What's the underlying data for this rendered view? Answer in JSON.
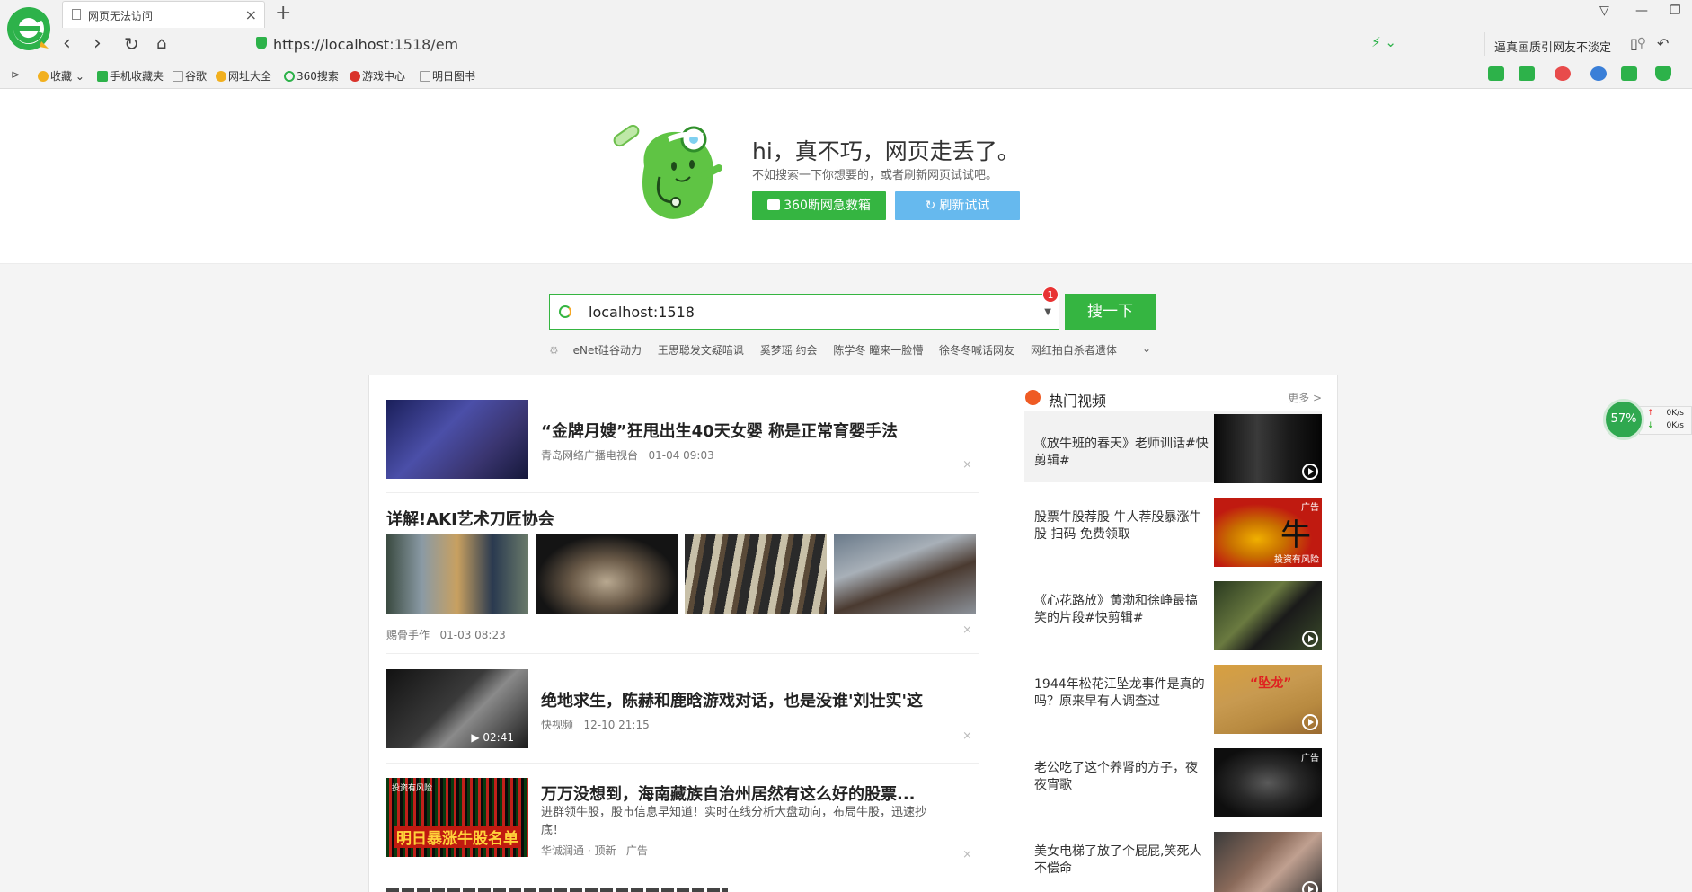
{
  "window": {
    "tab_title": "网页无法访问",
    "new_tab": "+",
    "url_prefix": "https://",
    "url_host": "localhost",
    "url_rest": ":1518/em",
    "search_placeholder": "逼真画质引网友不淡定"
  },
  "bookmarks": [
    {
      "label": "收藏",
      "color": "#f2b01e"
    },
    {
      "label": "手机收藏夹",
      "color": "#2db24a"
    },
    {
      "label": "谷歌",
      "color": "#999999"
    },
    {
      "label": "网址大全",
      "color": "#f2b01e"
    },
    {
      "label": "360搜索",
      "color": "#2db24a"
    },
    {
      "label": "游戏中心",
      "color": "#d9332b"
    },
    {
      "label": "明日图书",
      "color": "#999999"
    }
  ],
  "error": {
    "title": "hi，真不巧，网页走丢了。",
    "subtitle": "不如搜索一下你想要的，或者刷新网页试试吧。",
    "rescue_button": "360断网急救箱",
    "refresh_button": "刷新试试"
  },
  "search": {
    "value": "localhost:1518",
    "badge": "1",
    "button": "搜一下",
    "hot_words": [
      "eNet硅谷动力",
      "王思聪发文疑暗讽",
      "奚梦瑶 约会",
      "陈学冬 瞳来一脸懵",
      "徐冬冬喊话网友",
      "网红拍自杀者遗体"
    ]
  },
  "news": [
    {
      "title": "“金牌月嫂”狂甩出生40天女婴 称是正常育婴手法",
      "source": "青岛网络广播电视台",
      "time": "01-04 09:03"
    },
    {
      "title": "详解!AKI艺术刀匠协会",
      "source": "赐骨手作",
      "time": "01-03 08:23"
    },
    {
      "title": "绝地求生，陈赫和鹿晗游戏对话，也是没谁'刘壮实'这",
      "source": "快视频",
      "time": "12-10 21:15",
      "duration": "02:41"
    },
    {
      "title": "万万没想到，海南藏族自治州居然有这么好的股票...",
      "desc": "进群领牛股，股市信息早知道！实时在线分析大盘动向，布局牛股，迅速抄底！",
      "source": "华诚润通 · 顶新",
      "time": "广告",
      "thumb_text": "明日暴涨牛股名单",
      "thumb_tag": "投资有风险"
    }
  ],
  "sidebar": {
    "title": "热门视频",
    "more": "更多 >",
    "ad_label": "广告",
    "risk_label": "投资有风险",
    "videos": [
      {
        "title": "《放牛班的春天》老师训话#快剪辑#"
      },
      {
        "title": "股票牛股荐股 牛人荐股暴涨牛股 扫码 免费领取",
        "ad": "广告",
        "char": "牛"
      },
      {
        "title": "《心花路放》黄渤和徐峥最搞笑的片段#快剪辑#"
      },
      {
        "title": "1944年松花江坠龙事件是真的吗？原来早有人调查过",
        "tag": "“坠龙”"
      },
      {
        "title": "老公吃了这个养肾的方子，夜夜宵歌",
        "ad": "广告"
      },
      {
        "title": "美女电梯了放了个屁屁,笑死人不偿命"
      }
    ]
  },
  "net": {
    "percent": "57%",
    "up_speed": "0K/s",
    "down_speed": "0K/s"
  },
  "colors": {
    "accent": "#35b541",
    "refresh": "#66b9ee",
    "badge": "#e83333"
  }
}
